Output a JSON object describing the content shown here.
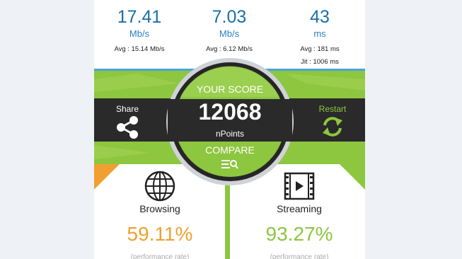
{
  "download": {
    "value": "17.41",
    "unit": "Mb/s",
    "avg": "Avg : 15.14 Mb/s"
  },
  "upload": {
    "value": "7.03",
    "unit": "Mb/s",
    "avg": "Avg : 6.12 Mb/s"
  },
  "latency": {
    "value": "43",
    "unit": "ms",
    "avg": "Avg : 181 ms",
    "jitter": "Jit : 1006 ms"
  },
  "share_label": "Share",
  "restart_label": "Restart",
  "score": {
    "heading": "YOUR SCORE",
    "value": "12068",
    "unit": "nPoints",
    "compare_label": "COMPARE"
  },
  "browsing": {
    "label": "Browsing",
    "percent": "59.11%",
    "note": "(performance rate)"
  },
  "streaming": {
    "label": "Streaming",
    "percent": "93.27%",
    "note": "(performance rate)"
  },
  "colors": {
    "green": "#8dc63f",
    "dark": "#2a2a2a",
    "orange": "#f0a030",
    "blue": "#1a6fa8"
  }
}
